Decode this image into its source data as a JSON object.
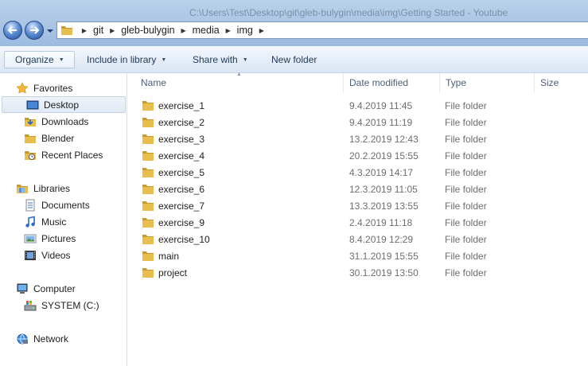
{
  "window": {
    "title": "C:\\Users\\Test\\Desktop\\git\\gleb-bulygin\\media\\img\\Getting Started - Youtube"
  },
  "address": {
    "breadcrumbs": [
      "git",
      "gleb-bulygin",
      "media",
      "img"
    ]
  },
  "toolbar": {
    "organize": "Organize",
    "include": "Include in library",
    "share": "Share with",
    "new_folder": "New folder"
  },
  "navigation": {
    "favorites": {
      "label": "Favorites",
      "items": [
        "Desktop",
        "Downloads",
        "Blender",
        "Recent Places"
      ]
    },
    "libraries": {
      "label": "Libraries",
      "items": [
        "Documents",
        "Music",
        "Pictures",
        "Videos"
      ]
    },
    "computer": {
      "label": "Computer",
      "items": [
        "SYSTEM (C:)"
      ]
    },
    "network": {
      "label": "Network"
    },
    "selected": "Desktop"
  },
  "columns": {
    "name": "Name",
    "date": "Date modified",
    "type": "Type",
    "size": "Size"
  },
  "files": [
    {
      "name": "exercise_1",
      "date": "9.4.2019 11:45",
      "type": "File folder"
    },
    {
      "name": "exercise_2",
      "date": "9.4.2019 11:19",
      "type": "File folder"
    },
    {
      "name": "exercise_3",
      "date": "13.2.2019 12:43",
      "type": "File folder"
    },
    {
      "name": "exercise_4",
      "date": "20.2.2019 15:55",
      "type": "File folder"
    },
    {
      "name": "exercise_5",
      "date": "4.3.2019 14:17",
      "type": "File folder"
    },
    {
      "name": "exercise_6",
      "date": "12.3.2019 11:05",
      "type": "File folder"
    },
    {
      "name": "exercise_7",
      "date": "13.3.2019 13:55",
      "type": "File folder"
    },
    {
      "name": "exercise_9",
      "date": "2.4.2019 11:18",
      "type": "File folder"
    },
    {
      "name": "exercise_10",
      "date": "8.4.2019 12:29",
      "type": "File folder"
    },
    {
      "name": "main",
      "date": "31.1.2019 15:55",
      "type": "File folder"
    },
    {
      "name": "project",
      "date": "30.1.2019 13:50",
      "type": "File folder"
    }
  ],
  "colors": {
    "folder": "#e8bf4f",
    "folder_dark": "#c99a2a",
    "chrome": "#b9d1ea",
    "selection": "#e1e9f3"
  }
}
